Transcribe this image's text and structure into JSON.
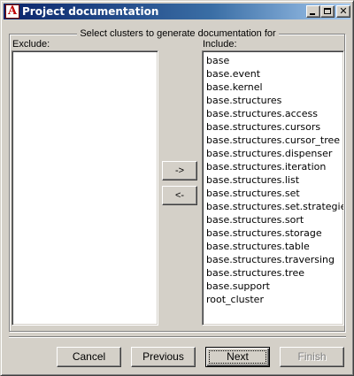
{
  "window": {
    "title": "Project documentation",
    "icon": "eiffel-app-icon",
    "icon_glyph": "A",
    "controls": {
      "minimize": "",
      "maximize": "",
      "close": "✕"
    }
  },
  "group": {
    "legend": "Select clusters to generate documentation for"
  },
  "exclude": {
    "label": "Exclude:",
    "items": []
  },
  "include": {
    "label": "Include:",
    "items": [
      "base",
      "base.event",
      "base.kernel",
      "base.structures",
      "base.structures.access",
      "base.structures.cursors",
      "base.structures.cursor_tree",
      "base.structures.dispenser",
      "base.structures.iteration",
      "base.structures.list",
      "base.structures.set",
      "base.structures.set.strategies",
      "base.structures.sort",
      "base.structures.storage",
      "base.structures.table",
      "base.structures.traversing",
      "base.structures.tree",
      "base.support",
      "root_cluster"
    ]
  },
  "move_buttons": {
    "to_include": "->",
    "to_exclude": "<-"
  },
  "footer": {
    "cancel": "Cancel",
    "previous": "Previous",
    "next": "Next",
    "finish": "Finish",
    "finish_enabled": false
  }
}
